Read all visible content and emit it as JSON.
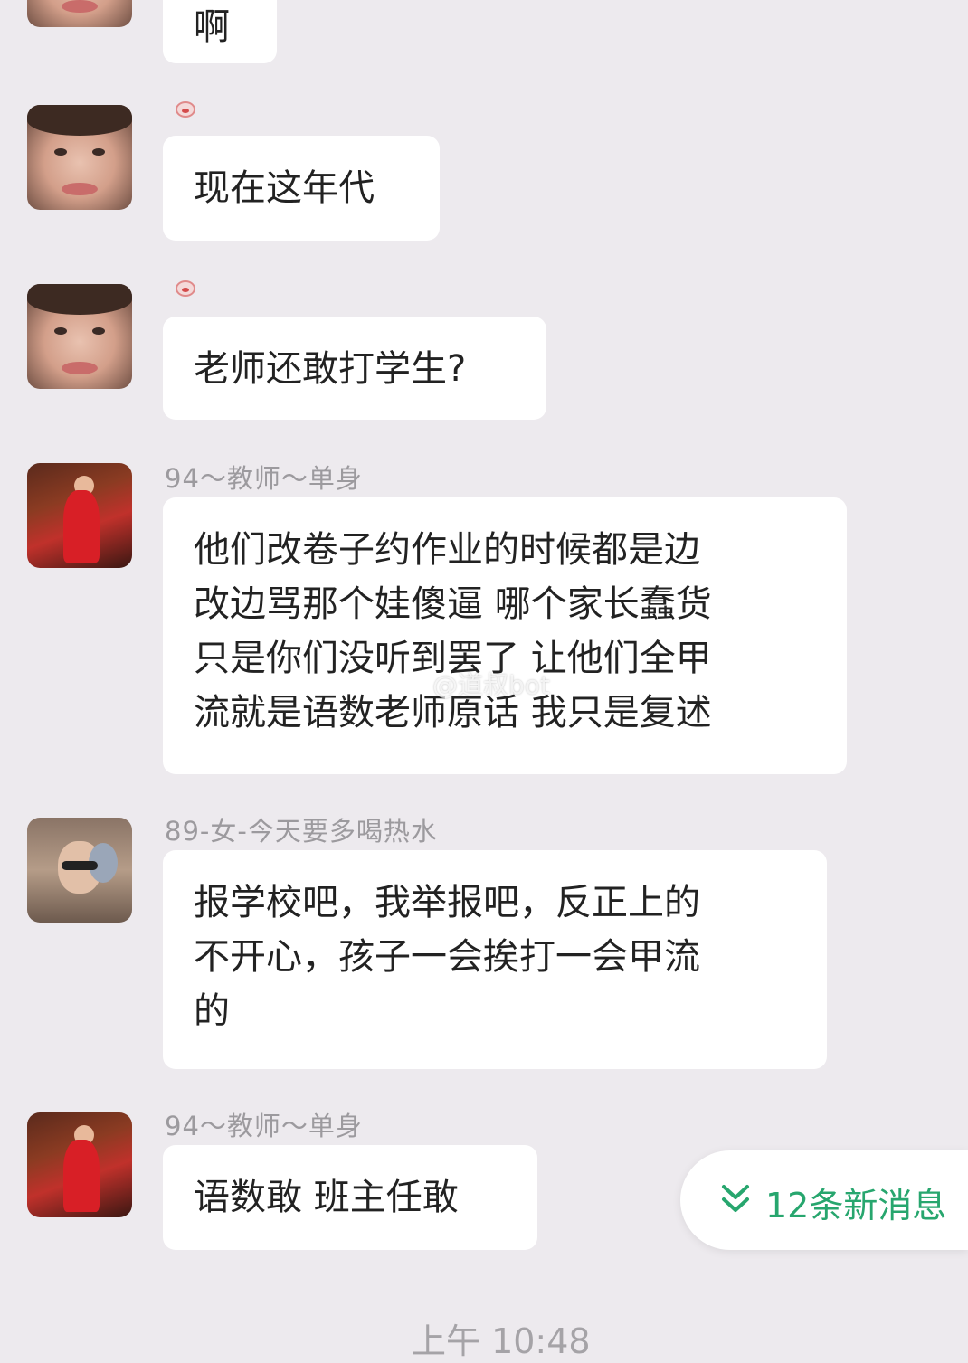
{
  "messages": [
    {
      "name": "",
      "text": "啊"
    },
    {
      "name": "",
      "text": "现在这年代"
    },
    {
      "name": "",
      "text": "老师还敢打学生?"
    },
    {
      "name": "94～教师～单身",
      "lines": [
        "他们改卷子约作业的时候都是边",
        "改边骂那个娃傻逼 哪个家长蠢货",
        "只是你们没听到罢了 让他们全甲",
        "流就是语数老师原话 我只是复述"
      ]
    },
    {
      "name": "89-女-今天要多喝热水",
      "lines": [
        "报学校吧，我举报吧，反正上的",
        "不开心，孩子一会挨打一会甲流",
        "的"
      ]
    },
    {
      "name": "94～教师～单身",
      "text": "语数敢 班主任敢"
    }
  ],
  "watermark": "@道叔bot",
  "new_messages_label": "12条新消息",
  "timestamp": "上午 10:48",
  "colors": {
    "background": "#edeaee",
    "bubble": "#ffffff",
    "accent": "#27a66e"
  }
}
